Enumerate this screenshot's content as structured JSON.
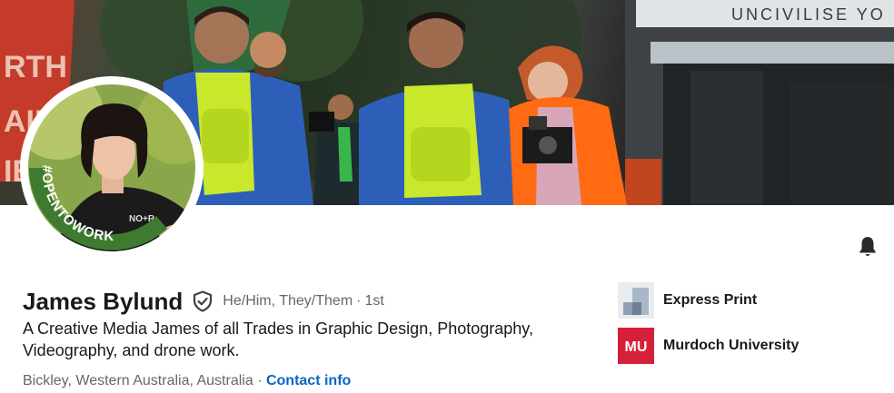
{
  "profile": {
    "name": "James Bylund",
    "pronouns": "He/Him, They/Them",
    "separator": "·",
    "degree": "1st",
    "headline": "A Creative Media James of all Trades in Graphic Design, Photography, Videography, and drone work.",
    "location": "Bickley, Western Australia, Australia",
    "location_separator": "·",
    "contact_link": "Contact info",
    "open_to_work_badge": "#OPENTOWORK"
  },
  "organizations": [
    {
      "name": "Express Print",
      "logo": "express-print-logo"
    },
    {
      "name": "Murdoch University",
      "logo": "murdoch-university-logo",
      "logo_text": "MU",
      "logo_color": "#d6203a"
    }
  ],
  "banner": {
    "sign_text": "UNCIVILISE YO",
    "flag_text": "RTH\nAIL\nIE"
  },
  "icons": {
    "verified": "shield-check-icon",
    "notifications": "bell-icon"
  },
  "colors": {
    "open_to_work_green": "#3f7a31",
    "link_blue": "#0a66c2",
    "hi_vis_yellow": "#c9e82c",
    "hi_vis_orange": "#ff6a13"
  }
}
